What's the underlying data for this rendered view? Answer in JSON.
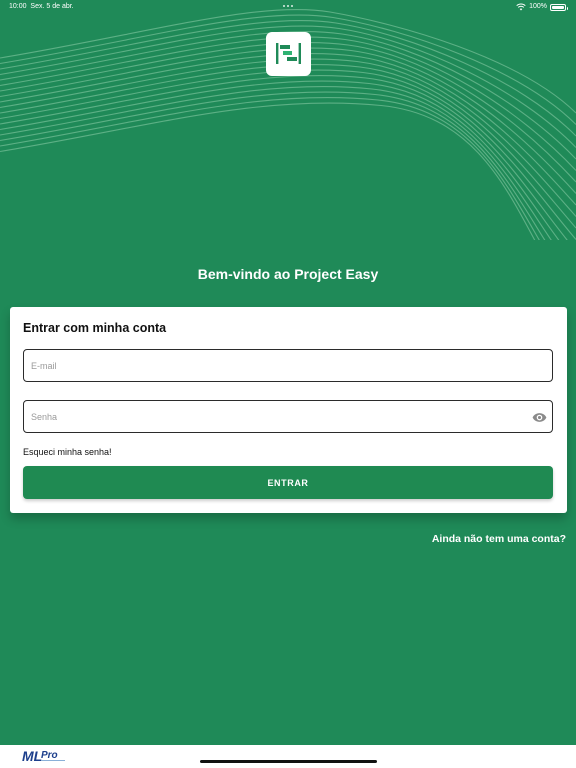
{
  "status_bar": {
    "time": "10:00",
    "date": "Sex. 5 de abr.",
    "battery": "100%"
  },
  "welcome_text": "Bem-vindo ao Project Easy",
  "login_card": {
    "title": "Entrar com minha conta",
    "email_placeholder": "E-mail",
    "password_placeholder": "Senha",
    "forgot_password": "Esqueci minha senha!",
    "submit_label": "ENTRAR"
  },
  "signup_link": "Ainda não tem uma conta?",
  "footer": {
    "brand_logo": "MLPro"
  },
  "colors": {
    "primary_green": "#1f8a58",
    "button_green": "#1f8a52",
    "card_background": "#ffffff"
  },
  "icons": {
    "app_logo": "project-easy-logo-icon",
    "password_toggle": "eye-icon",
    "wifi": "wifi-icon",
    "battery": "battery-icon"
  }
}
